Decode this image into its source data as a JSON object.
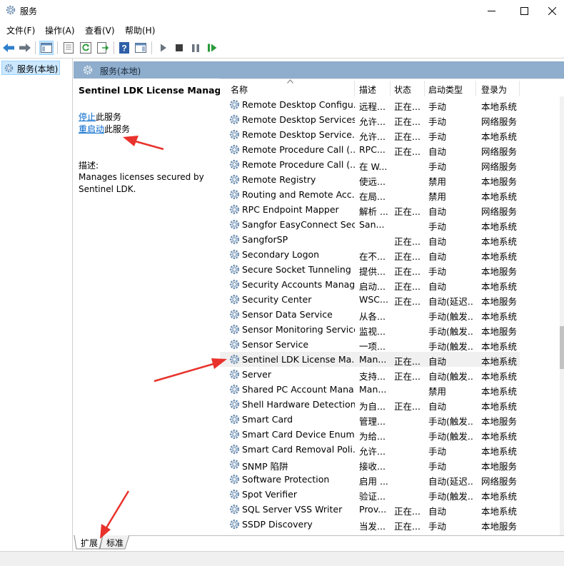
{
  "window": {
    "title": "服务",
    "icons": {
      "app": "gear-services-icon",
      "minimize": "minimize-icon",
      "maximize": "maximize-icon",
      "close": "close-icon"
    }
  },
  "menu": [
    "文件(F)",
    "操作(A)",
    "查看(V)",
    "帮助(H)"
  ],
  "toolbar": {
    "icons": [
      "back-arrow-icon",
      "forward-arrow-icon",
      "show-hide-console-tree-icon",
      "properties-icon",
      "refresh-icon",
      "export-list-icon",
      "help-icon",
      "show-action-pane-icon",
      "start-service-icon",
      "stop-service-icon",
      "pause-service-icon",
      "resume-service-icon"
    ]
  },
  "tree": {
    "node": "服务(本地)"
  },
  "pane": {
    "header": "服务(本地)"
  },
  "details": {
    "service_name": "Sentinel LDK License Manager",
    "stop_link": "停止",
    "stop_suffix": "此服务",
    "restart_link": "重启动",
    "restart_suffix": "此服务",
    "desc_label": "描述:",
    "desc_text": "Manages licenses secured by Sentinel LDK."
  },
  "columns": {
    "name": "名称",
    "desc": "描述",
    "status": "状态",
    "startup": "启动类型",
    "logon": "登录为"
  },
  "rows": [
    {
      "name": "Remote Desktop Configu...",
      "desc": "远程...",
      "status": "正在...",
      "startup": "手动",
      "logon": "本地系统"
    },
    {
      "name": "Remote Desktop Services",
      "desc": "允许...",
      "status": "正在...",
      "startup": "手动",
      "logon": "网络服务"
    },
    {
      "name": "Remote Desktop Service...",
      "desc": "允许...",
      "status": "正在...",
      "startup": "手动",
      "logon": "本地系统"
    },
    {
      "name": "Remote Procedure Call (...",
      "desc": "RPC...",
      "status": "正在...",
      "startup": "自动",
      "logon": "网络服务"
    },
    {
      "name": "Remote Procedure Call (...",
      "desc": "在 W...",
      "status": "",
      "startup": "手动",
      "logon": "网络服务"
    },
    {
      "name": "Remote Registry",
      "desc": "使远...",
      "status": "",
      "startup": "禁用",
      "logon": "本地服务"
    },
    {
      "name": "Routing and Remote Acc...",
      "desc": "在局...",
      "status": "",
      "startup": "禁用",
      "logon": "本地系统"
    },
    {
      "name": "RPC Endpoint Mapper",
      "desc": "解析 ...",
      "status": "正在...",
      "startup": "自动",
      "logon": "网络服务"
    },
    {
      "name": "Sangfor EasyConnect Sec...",
      "desc": "San...",
      "status": "",
      "startup": "手动",
      "logon": "本地系统"
    },
    {
      "name": "SangforSP",
      "desc": "",
      "status": "正在...",
      "startup": "自动",
      "logon": "本地系统"
    },
    {
      "name": "Secondary Logon",
      "desc": "在不...",
      "status": "正在...",
      "startup": "自动",
      "logon": "本地系统"
    },
    {
      "name": "Secure Socket Tunneling ...",
      "desc": "提供...",
      "status": "正在...",
      "startup": "手动",
      "logon": "本地服务"
    },
    {
      "name": "Security Accounts Manag...",
      "desc": "启动...",
      "status": "正在...",
      "startup": "自动",
      "logon": "本地系统"
    },
    {
      "name": "Security Center",
      "desc": "WSC...",
      "status": "正在...",
      "startup": "自动(延迟...",
      "logon": "本地服务"
    },
    {
      "name": "Sensor Data Service",
      "desc": "从各...",
      "status": "",
      "startup": "手动(触发...",
      "logon": "本地系统"
    },
    {
      "name": "Sensor Monitoring Service",
      "desc": "监视...",
      "status": "",
      "startup": "手动(触发...",
      "logon": "本地服务"
    },
    {
      "name": "Sensor Service",
      "desc": "一项...",
      "status": "",
      "startup": "手动(触发...",
      "logon": "本地系统"
    },
    {
      "name": "Sentinel LDK License Ma...",
      "desc": "Man...",
      "status": "正在...",
      "startup": "自动",
      "logon": "本地系统",
      "selected": true
    },
    {
      "name": "Server",
      "desc": "支持...",
      "status": "正在...",
      "startup": "自动(触发...",
      "logon": "本地系统"
    },
    {
      "name": "Shared PC Account Mana...",
      "desc": "Man...",
      "status": "",
      "startup": "禁用",
      "logon": "本地系统"
    },
    {
      "name": "Shell Hardware Detection",
      "desc": "为自...",
      "status": "正在...",
      "startup": "自动",
      "logon": "本地系统"
    },
    {
      "name": "Smart Card",
      "desc": "管理...",
      "status": "",
      "startup": "手动(触发...",
      "logon": "本地服务"
    },
    {
      "name": "Smart Card Device Enum...",
      "desc": "为给...",
      "status": "",
      "startup": "手动(触发...",
      "logon": "本地系统"
    },
    {
      "name": "Smart Card Removal Poli...",
      "desc": "允许...",
      "status": "",
      "startup": "手动",
      "logon": "本地系统"
    },
    {
      "name": "SNMP 陷阱",
      "desc": "接收...",
      "status": "",
      "startup": "手动",
      "logon": "本地服务"
    },
    {
      "name": "Software Protection",
      "desc": "启用 ...",
      "status": "",
      "startup": "自动(延迟...",
      "logon": "网络服务"
    },
    {
      "name": "Spot Verifier",
      "desc": "验证...",
      "status": "",
      "startup": "手动(触发...",
      "logon": "本地系统"
    },
    {
      "name": "SQL Server VSS Writer",
      "desc": "Prov...",
      "status": "正在...",
      "startup": "自动",
      "logon": "本地系统"
    },
    {
      "name": "SSDP Discovery",
      "desc": "当发...",
      "status": "正在...",
      "startup": "手动",
      "logon": "本地服务"
    }
  ],
  "tabs": [
    "扩展",
    "标准"
  ],
  "colors": {
    "header_bg": "#8fadcc",
    "selection": "#cce8ff",
    "link": "#0066cc",
    "annotation_arrow": "#e8322b"
  }
}
